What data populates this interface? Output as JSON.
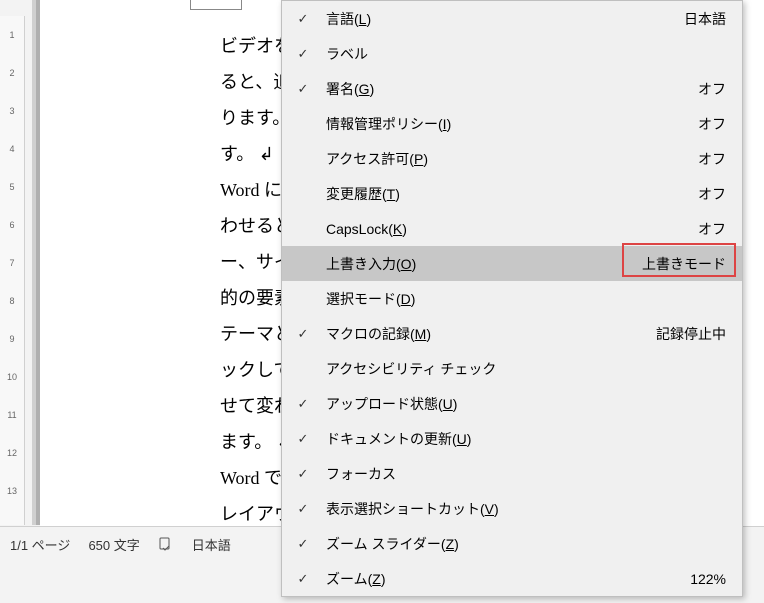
{
  "ruler": [
    "1",
    "2",
    "3",
    "4",
    "5",
    "6",
    "7",
    "8",
    "9",
    "10",
    "11",
    "12",
    "13"
  ],
  "document_lines": [
    "ビデオを使うと、伝えたい内容を明確に表現できます。[オ",
    "ると、追加したいビデオを、それに応じた埋め込みコードの",
    "ります。キーワードを入力して、文書に最適なビデオをオ",
    "す。 ↲",
    "Word に用意されているヘッダー、フッター、表紙、テキ",
    "わせると、プロのようなできばえの文書を作成できます。",
    "ー、サイドバー、表紙などの文書パーツを追加できます。てた",
    "的の要素を選んでください。 ↲",
    "テーマとスタイルを使って、文書全体の統一感を出すこと",
    "ックして新しいテーマを選ぶと、図やグラフ、SmartArt グ",
    "せて変わります。スタイルを適用すると、見出しが新しいマに",
    "ます。 ↲",
    "Word では、必要に応じてその場に新しいボタンが示さ",
    "レイアウトを変更するには、オブジェクト内をクリックするさ"
  ],
  "statusbar": {
    "page": "1/1 ページ",
    "words": "650 文字",
    "spellcheck_icon": "spellcheck-icon",
    "language": "日本語",
    "overtype": "上書きモード"
  },
  "menu": [
    {
      "checked": true,
      "label_pre": "言語(",
      "key": "L",
      "label_post": ")",
      "status": "日本語"
    },
    {
      "checked": true,
      "label_pre": "ラベル",
      "key": "",
      "label_post": "",
      "status": ""
    },
    {
      "checked": true,
      "label_pre": "署名(",
      "key": "G",
      "label_post": ")",
      "status": "オフ"
    },
    {
      "checked": false,
      "label_pre": "情報管理ポリシー(",
      "key": "I",
      "label_post": ")",
      "status": "オフ"
    },
    {
      "checked": false,
      "label_pre": "アクセス許可(",
      "key": "P",
      "label_post": ")",
      "status": "オフ"
    },
    {
      "checked": false,
      "label_pre": "変更履歴(",
      "key": "T",
      "label_post": ")",
      "status": "オフ"
    },
    {
      "checked": false,
      "label_pre": "CapsLock(",
      "key": "K",
      "label_post": ")",
      "status": "オフ"
    },
    {
      "checked": false,
      "label_pre": "上書き入力(",
      "key": "O",
      "label_post": ")",
      "status": "上書きモード",
      "hover": true
    },
    {
      "checked": false,
      "label_pre": "選択モード(",
      "key": "D",
      "label_post": ")",
      "status": ""
    },
    {
      "checked": true,
      "label_pre": "マクロの記録(",
      "key": "M",
      "label_post": ")",
      "status": "記録停止中"
    },
    {
      "checked": false,
      "label_pre": "アクセシビリティ チェック",
      "key": "",
      "label_post": "",
      "status": ""
    },
    {
      "checked": true,
      "label_pre": "アップロード状態(",
      "key": "U",
      "label_post": ")",
      "status": ""
    },
    {
      "checked": true,
      "label_pre": "ドキュメントの更新(",
      "key": "U",
      "label_post": ")",
      "status": ""
    },
    {
      "checked": true,
      "label_pre": "フォーカス",
      "key": "",
      "label_post": "",
      "status": ""
    },
    {
      "checked": true,
      "label_pre": "表示選択ショートカット(",
      "key": "V",
      "label_post": ")",
      "status": ""
    },
    {
      "checked": true,
      "label_pre": "ズーム スライダー(",
      "key": "Z",
      "label_post": ")",
      "status": ""
    },
    {
      "checked": true,
      "label_pre": "ズーム(",
      "key": "Z",
      "label_post": ")",
      "status": "122%"
    }
  ]
}
